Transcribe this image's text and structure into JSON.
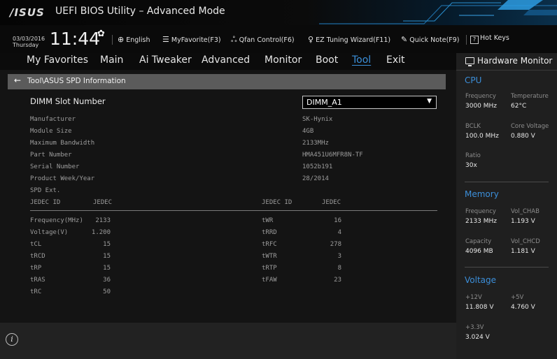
{
  "window": {
    "logo": "/ISUS",
    "title": "UEFI BIOS Utility – Advanced Mode"
  },
  "infobar": {
    "date": "03/03/2016",
    "day": "Thursday",
    "time": "11:44",
    "language": "English",
    "myfavorite": "MyFavorite(F3)",
    "qfan": "Qfan Control(F6)",
    "ez_tuning": "EZ Tuning Wizard(F11)",
    "quick_note": "Quick Note(F9)",
    "hot_keys": "Hot Keys",
    "icons": [
      "gear-icon",
      "globe-icon",
      "favorite-icon",
      "fan-icon",
      "bulb-icon",
      "note-icon",
      "help-icon"
    ]
  },
  "menu": {
    "tabs": [
      {
        "label": "My Favorites"
      },
      {
        "label": "Main"
      },
      {
        "label": "Ai Tweaker"
      },
      {
        "label": "Advanced"
      },
      {
        "label": "Monitor"
      },
      {
        "label": "Boot"
      },
      {
        "label": "Tool",
        "active": true
      },
      {
        "label": "Exit"
      }
    ]
  },
  "breadcrumb": "Tool\\ASUS SPD Information",
  "dimm": {
    "label": "DIMM Slot Number",
    "selected": "DIMM_A1"
  },
  "spd": {
    "fields": [
      {
        "label": "Manufacturer",
        "value": "SK-Hynix"
      },
      {
        "label": "Module Size",
        "value": "4GB"
      },
      {
        "label": "Maximum Bandwidth",
        "value": "2133MHz"
      },
      {
        "label": "Part Number",
        "value": "HMA451U6MFR8N-TF"
      },
      {
        "label": "Serial Number",
        "value": "1052b191"
      },
      {
        "label": "Product Week/Year",
        "value": "28/2014"
      }
    ],
    "ext_label": "SPD Ext.",
    "jedec_header": [
      "JEDEC ID",
      "JEDEC",
      "JEDEC ID",
      "JEDEC"
    ],
    "timings_left": [
      {
        "name": "Frequency(MHz)",
        "value": "2133"
      },
      {
        "name": "Voltage(V)",
        "value": "1.200"
      },
      {
        "name": "tCL",
        "value": "15"
      },
      {
        "name": "tRCD",
        "value": "15"
      },
      {
        "name": "tRP",
        "value": "15"
      },
      {
        "name": "tRAS",
        "value": "36"
      },
      {
        "name": "tRC",
        "value": "50"
      }
    ],
    "timings_right": [
      {
        "name": "tWR",
        "value": "16"
      },
      {
        "name": "tRRD",
        "value": "4"
      },
      {
        "name": "tRFC",
        "value": "278"
      },
      {
        "name": "tWTR",
        "value": "3"
      },
      {
        "name": "tRTP",
        "value": "8"
      },
      {
        "name": "tFAW",
        "value": "23"
      }
    ]
  },
  "hw": {
    "title": "Hardware Monitor",
    "cpu": {
      "heading": "CPU",
      "frequency_label": "Frequency",
      "frequency": "3000 MHz",
      "temperature_label": "Temperature",
      "temperature": "62°C",
      "bclk_label": "BCLK",
      "bclk": "100.0 MHz",
      "core_voltage_label": "Core Voltage",
      "core_voltage": "0.880 V",
      "ratio_label": "Ratio",
      "ratio": "30x"
    },
    "memory": {
      "heading": "Memory",
      "frequency_label": "Frequency",
      "frequency": "2133 MHz",
      "vol_chab_label": "Vol_CHAB",
      "vol_chab": "1.193 V",
      "capacity_label": "Capacity",
      "capacity": "4096 MB",
      "vol_chcd_label": "Vol_CHCD",
      "vol_chcd": "1.181 V"
    },
    "voltage": {
      "heading": "Voltage",
      "v12_label": "+12V",
      "v12": "11.808 V",
      "v5_label": "+5V",
      "v5": "4.760 V",
      "v33_label": "+3.3V",
      "v33": "3.024 V"
    }
  },
  "colors": {
    "accent": "#3b8fd9",
    "panel": "#141414",
    "monitor_bg": "#1f1f1f",
    "breadcrumb_bg": "#5b5b5b"
  }
}
